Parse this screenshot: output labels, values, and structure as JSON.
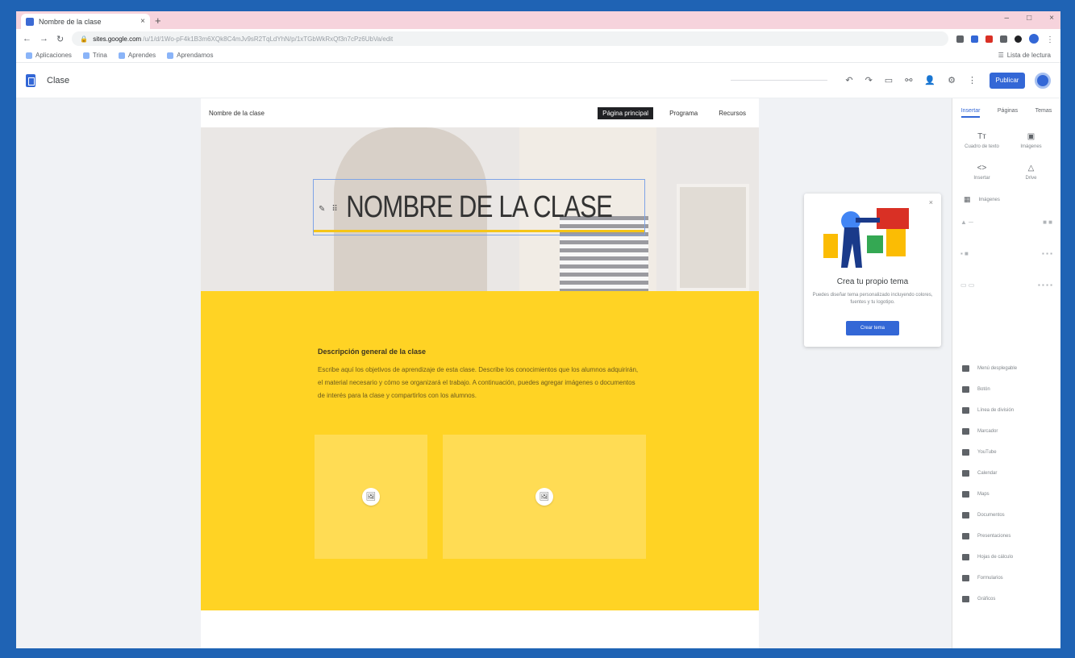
{
  "browser": {
    "tab_title": "Nombre de la clase",
    "tab_close": "×",
    "new_tab": "+",
    "window_controls": [
      "–",
      "□",
      "×"
    ],
    "url_host": "sites.google.com",
    "url_path": "/u/1/d/1Wo-pF4k1B3m6XQk8C4mJv9sR2TqLdYhN/p/1xTGbWkRxQf3n7cPz6UbVa/edit",
    "bookmarks": [
      "Aplicaciones",
      "Trina",
      "Aprendes",
      "Aprendamos"
    ],
    "reading_list": "Lista de lectura"
  },
  "app": {
    "title": "Clase",
    "publish_label": "Publicar",
    "toolbar_icons": [
      "undo-icon",
      "redo-icon",
      "preview-icon",
      "link-icon",
      "share-icon",
      "settings-icon",
      "more-icon"
    ]
  },
  "site": {
    "name": "Nombre de la clase",
    "nav": [
      "Página principal",
      "Programa",
      "Recursos"
    ],
    "hero_title": "NOMBRE DE LA CLASE",
    "overview_heading": "Descripción general de la clase",
    "overview_body": "Escribe aquí los objetivos de aprendizaje de esta clase. Describe los conocimientos que los alumnos adquirirán, el material necesario y cómo se organizará el trabajo. A continuación, puedes agregar imágenes o documentos de interés para la clase y compartirlos con los alumnos."
  },
  "popup": {
    "close": "×",
    "heading": "Crea tu propio tema",
    "text": "Puedes diseñar tema personalizado incluyendo colores, fuentes y tu logotipo.",
    "button": "Crear tema"
  },
  "panel": {
    "tabs": [
      "Insertar",
      "Páginas",
      "Temas"
    ],
    "grid_items": [
      {
        "icon": "text-box-icon",
        "label": "Cuadro de texto"
      },
      {
        "icon": "images-icon",
        "label": "Imágenes"
      },
      {
        "icon": "embed-icon",
        "label": "Insertar"
      },
      {
        "icon": "drive-icon",
        "label": "Drive"
      }
    ],
    "images_label": "Imágenes",
    "list_items": [
      "Menú desplegable",
      "Botón",
      "Línea de división",
      "Marcador",
      "YouTube",
      "Calendar",
      "Maps",
      "Documentos",
      "Presentaciones",
      "Hojas de cálculo",
      "Formularios",
      "Gráficos"
    ],
    "colors": {
      "accent": "#3367d6",
      "yellow": "#ffd324"
    }
  }
}
